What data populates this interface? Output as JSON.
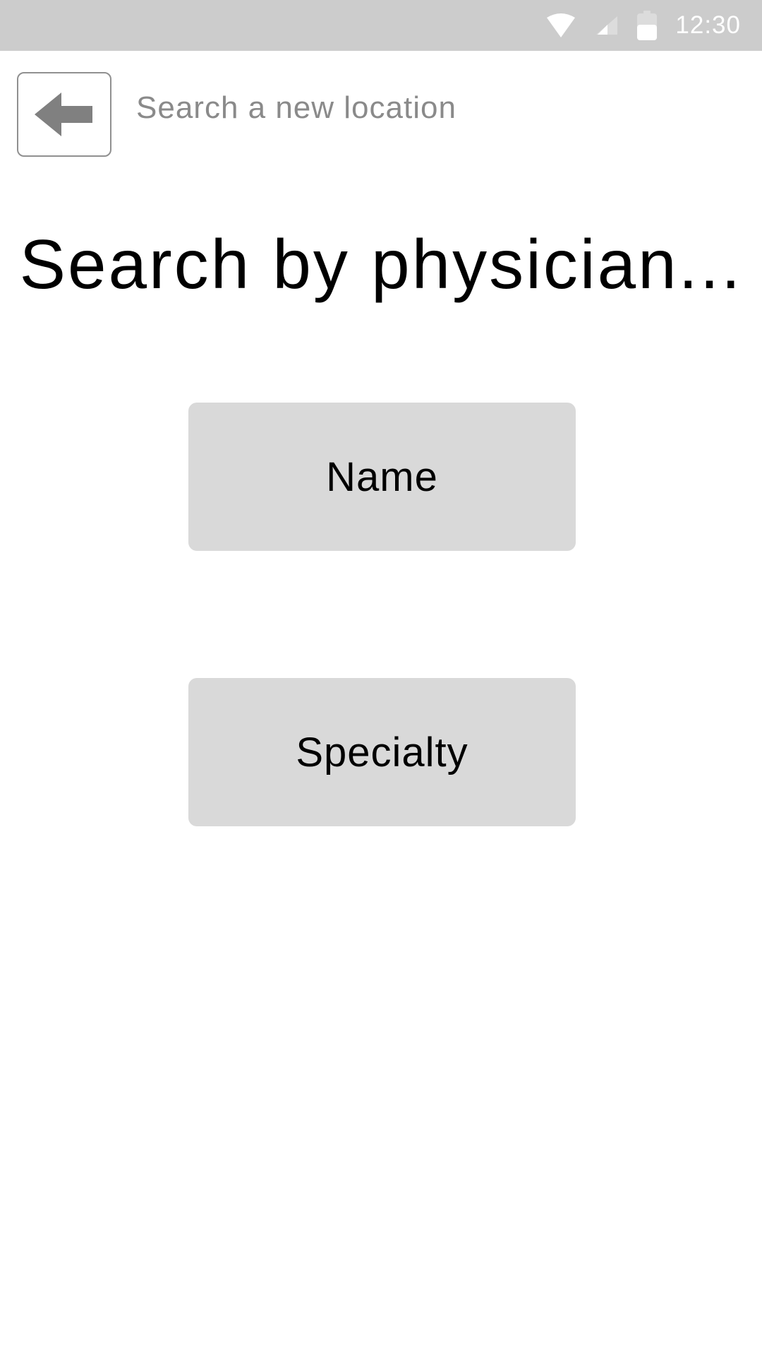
{
  "status_bar": {
    "time": "12:30",
    "icons": [
      "wifi-icon",
      "cell-signal-icon",
      "battery-icon"
    ],
    "background": "#cccccc"
  },
  "header": {
    "back_icon": "arrow-left-icon",
    "back_link_label": "Search a new location"
  },
  "main": {
    "title": "Search by physician...",
    "options": [
      {
        "label": "Name"
      },
      {
        "label": "Specialty"
      }
    ]
  },
  "colors": {
    "button_background": "#d9d9d9",
    "muted_text": "#8a8a8a",
    "border": "#909090"
  }
}
